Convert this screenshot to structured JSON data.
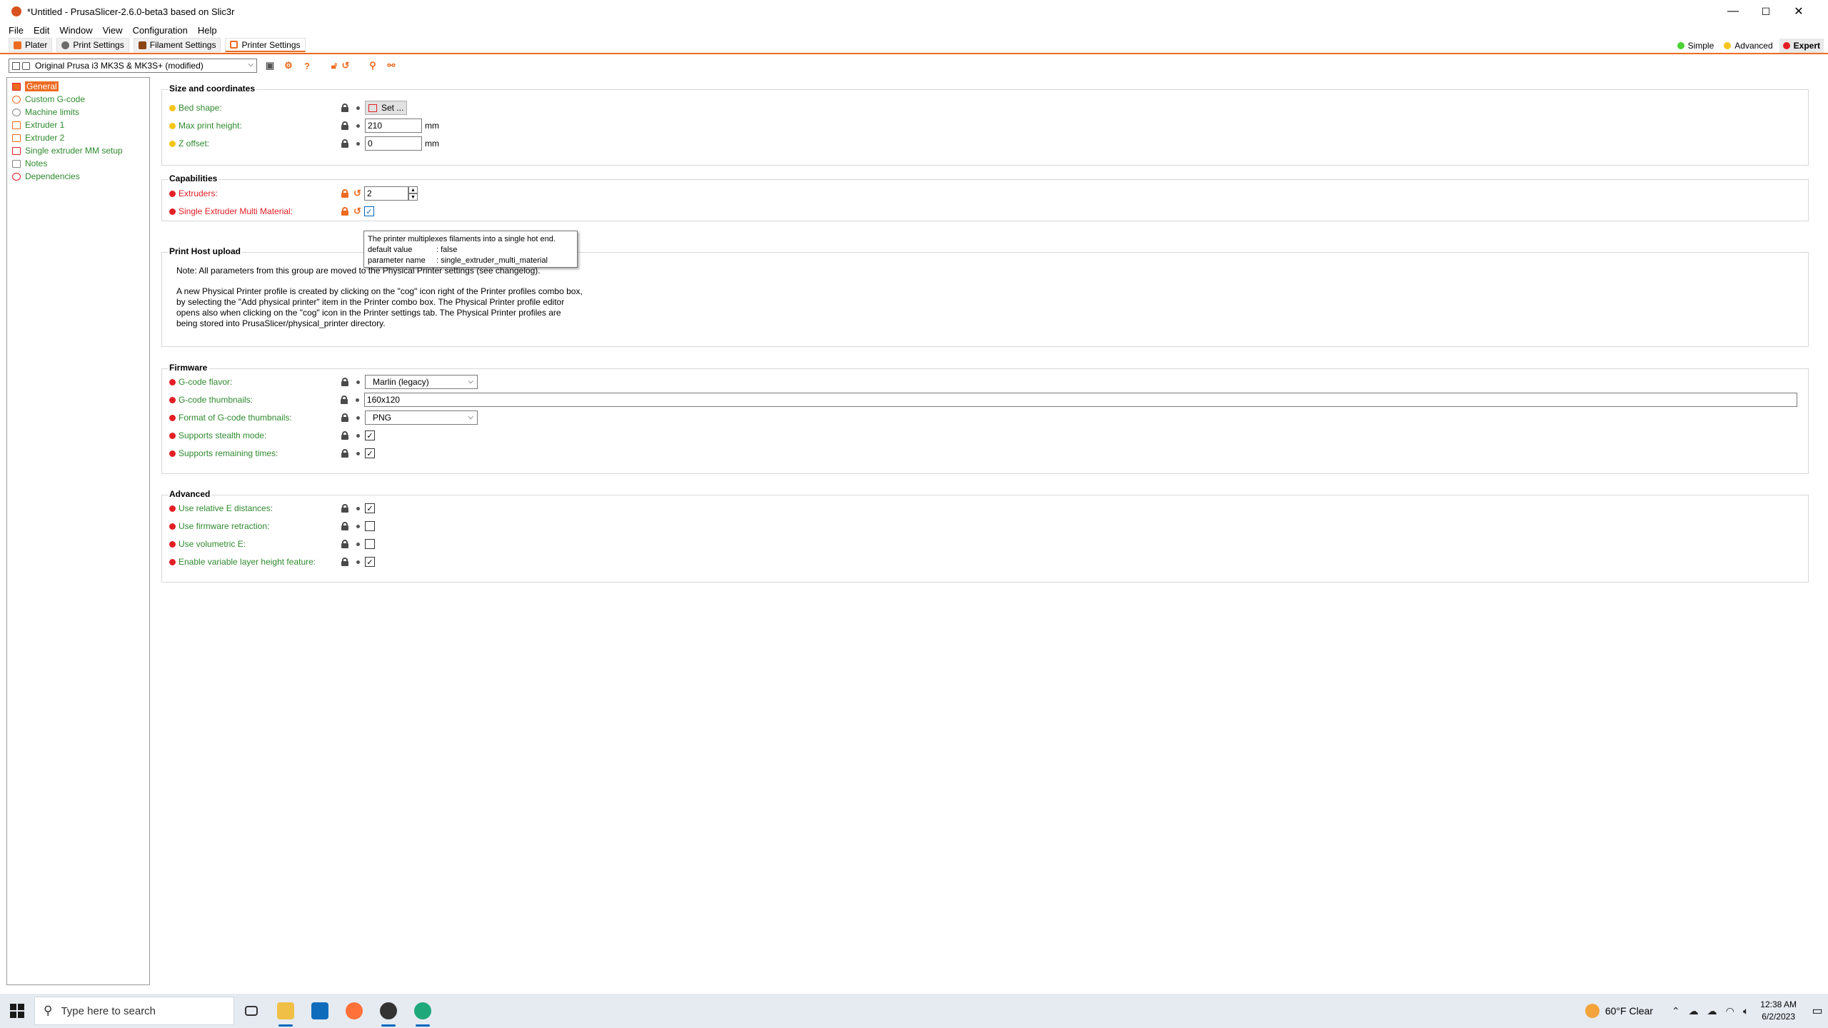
{
  "window": {
    "title": "*Untitled - PrusaSlicer-2.6.0-beta3 based on Slic3r",
    "minimize": "—",
    "maximize": "☐",
    "close": "✕"
  },
  "menu": [
    "File",
    "Edit",
    "Window",
    "View",
    "Configuration",
    "Help"
  ],
  "tabs": [
    {
      "label": "Plater",
      "color": "#ed6b21"
    },
    {
      "label": "Print Settings",
      "color": "#6b6b6b"
    },
    {
      "label": "Filament Settings",
      "color": "#8b4513"
    },
    {
      "label": "Printer Settings",
      "color": "#ed6b21"
    }
  ],
  "modes": [
    {
      "label": "Simple",
      "color": "#4cd137"
    },
    {
      "label": "Advanced",
      "color": "#f5c518"
    },
    {
      "label": "Expert",
      "color": "#e31e24"
    }
  ],
  "preset": {
    "value": "Original Prusa i3 MK3S & MK3S+ (modified)"
  },
  "sidebar": [
    {
      "label": "General",
      "selected": true
    },
    {
      "label": "Custom G-code"
    },
    {
      "label": "Machine limits"
    },
    {
      "label": "Extruder 1"
    },
    {
      "label": "Extruder 2"
    },
    {
      "label": "Single extruder MM setup"
    },
    {
      "label": "Notes"
    },
    {
      "label": "Dependencies"
    }
  ],
  "groups": {
    "size": {
      "title": "Size and coordinates",
      "bed_shape": "Bed shape:",
      "bed_button": "Set ...",
      "max_height": "Max print height:",
      "max_height_value": "210",
      "z_offset": "Z offset:",
      "z_offset_value": "0",
      "unit": "mm"
    },
    "capabilities": {
      "title": "Capabilities",
      "extruders": "Extruders:",
      "extruders_value": "2",
      "semm": "Single Extruder Multi Material:"
    },
    "host": {
      "title": "Print Host upload",
      "note1": "Note: All parameters from this group are moved to the Physical Printer settings (see changelog).",
      "note2": "A new Physical Printer profile is created by clicking on the \"cog\" icon right of the Printer profiles combo box, by selecting the \"Add physical printer\" item in the Printer combo box. The Physical Printer profile editor opens also when clicking on the \"cog\" icon in the Printer settings tab. The Physical Printer profiles are being stored into PrusaSlicer/physical_printer directory."
    },
    "firmware": {
      "title": "Firmware",
      "flavor": "G-code flavor:",
      "flavor_value": "Marlin (legacy)",
      "thumbs": "G-code thumbnails:",
      "thumbs_value": "160x120",
      "thumb_format": "Format of G-code thumbnails:",
      "thumb_format_value": "PNG",
      "stealth": "Supports stealth mode:",
      "remaining": "Supports remaining times:"
    },
    "advanced": {
      "title": "Advanced",
      "relative_e": "Use relative E distances:",
      "fw_retraction": "Use firmware retraction:",
      "volumetric": "Use volumetric E:",
      "var_layer": "Enable variable layer height feature:"
    }
  },
  "tooltip": {
    "line1": "The printer multiplexes filaments into a single hot end.",
    "k2": "default value",
    "v2": ": false",
    "k3": "parameter name",
    "v3": ": single_extruder_multi_material"
  },
  "taskbar": {
    "search_placeholder": "Type here to search",
    "weather": "60°F  Clear",
    "time": "12:38 AM",
    "date": "6/2/2023"
  },
  "colors": {
    "accent": "#ed6b21",
    "green_label": "#2f8a2f",
    "red_label": "#e31e24",
    "yellow_bullet": "#f5c518"
  }
}
